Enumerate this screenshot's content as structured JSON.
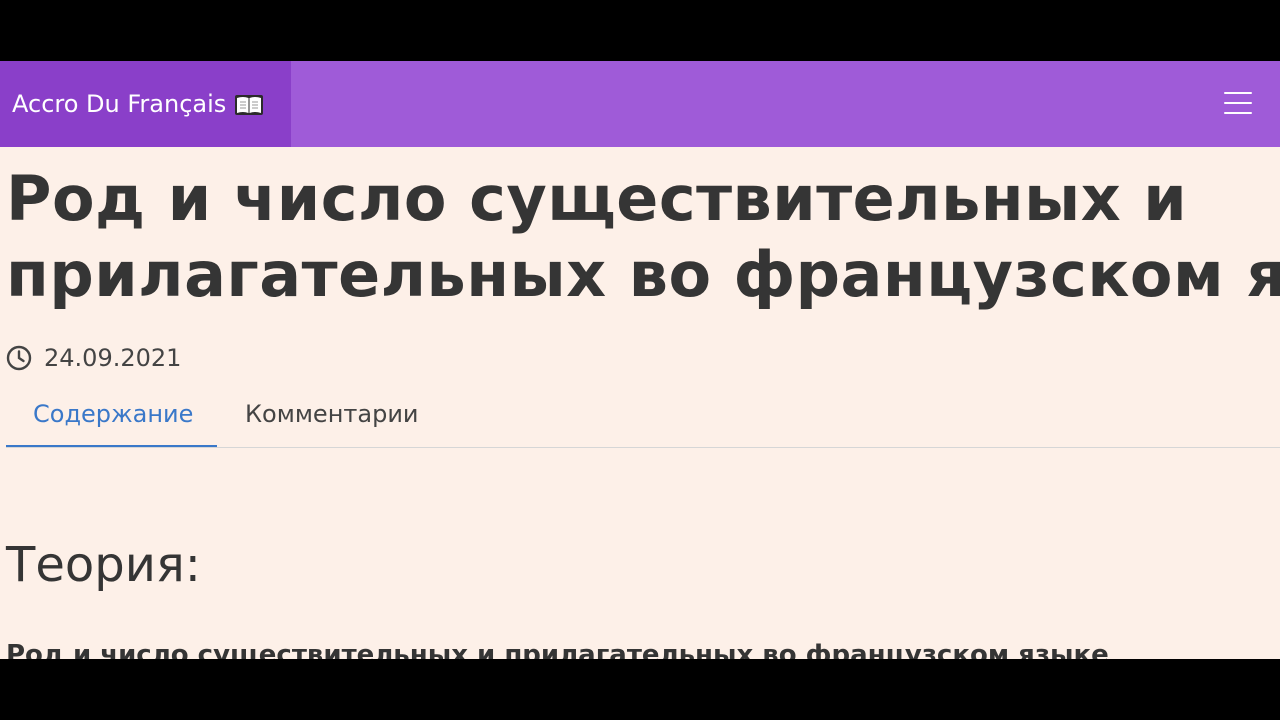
{
  "navbar": {
    "brand_text": "Accro Du Français",
    "brand_icon": "open-book-icon",
    "menu_icon": "hamburger-menu-icon",
    "background_color": "#9f5bd8",
    "brand_background_color": "#8a3fc9"
  },
  "article": {
    "title_line1": "Род и число существительных и",
    "title_line2": "прилагательных во французском языке",
    "date": "24.09.2021",
    "date_icon": "clock-icon"
  },
  "tabs": [
    {
      "label": "Содержание",
      "active": true
    },
    {
      "label": "Комментарии",
      "active": false
    }
  ],
  "content": {
    "section_heading": "Теория:",
    "subheading": "Род и число существительных и прилагательных во французском языке"
  },
  "colors": {
    "page_background": "#fdf0e8",
    "active_tab": "#3a78c9",
    "text": "#353535"
  }
}
